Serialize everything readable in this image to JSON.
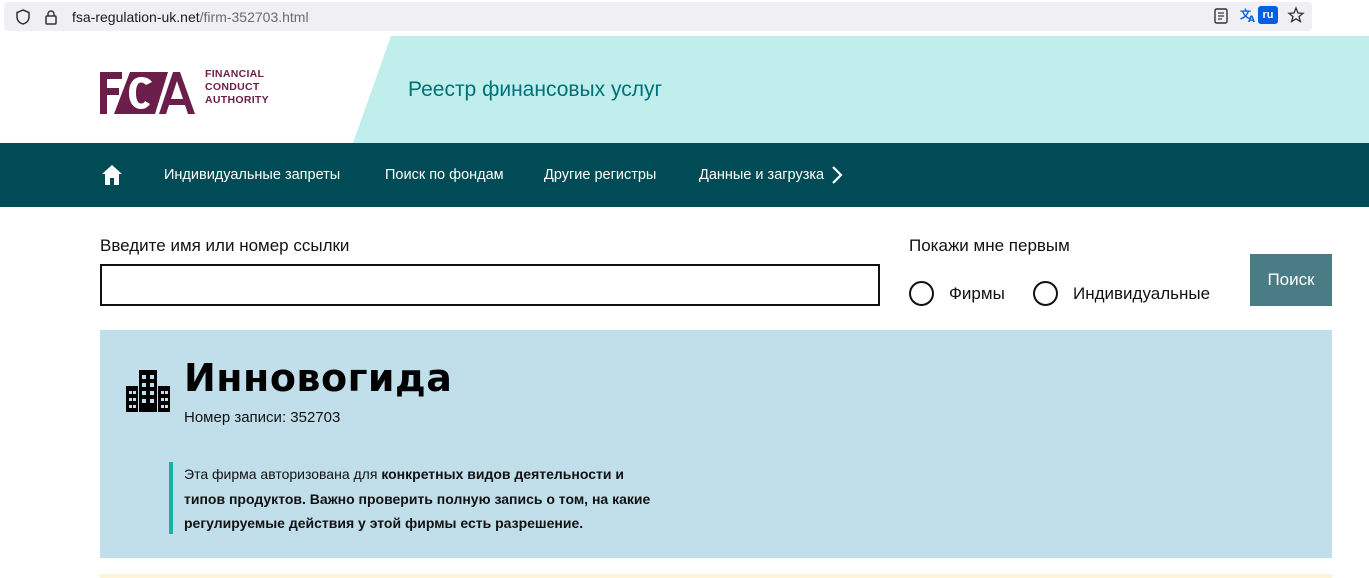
{
  "browser": {
    "url_host": "fsa-regulation-uk.net",
    "url_path": "/firm-352703.html",
    "translate_badge": "ru"
  },
  "header": {
    "logo_letters": "FCA",
    "logo_text_line1": "FINANCIAL",
    "logo_text_line2": "CONDUCT",
    "logo_text_line3": "AUTHORITY",
    "register_title": "Реестр финансовых услуг"
  },
  "nav": {
    "items": [
      {
        "label": "Индивидуальные запреты"
      },
      {
        "label": "Поиск по фондам"
      },
      {
        "label": "Другие регистры"
      },
      {
        "label": "Данные и загрузка"
      }
    ]
  },
  "search": {
    "label": "Введите имя или номер ссылки",
    "value": "",
    "show_first_label": "Покажи мне первым",
    "option_firms": "Фирмы",
    "option_individuals": "Индивидуальные",
    "button_label": "Поиск"
  },
  "firm": {
    "name": "Инновогида",
    "reference": "Номер записи: 352703",
    "notice_plain": "Эта фирма авторизована для ",
    "notice_bold": "конкретных видов деятельности и типов продуктов. Важно проверить полную запись о том, на какие регулируемые действия у этой фирмы есть разрешение."
  },
  "colors": {
    "brand_purple": "#6c1e4b",
    "nav_teal": "#004b56",
    "header_teal": "#bfeeec",
    "panel_blue": "#c0dfea",
    "accent_green": "#1ab1a3",
    "button_teal": "#4a7c86"
  }
}
